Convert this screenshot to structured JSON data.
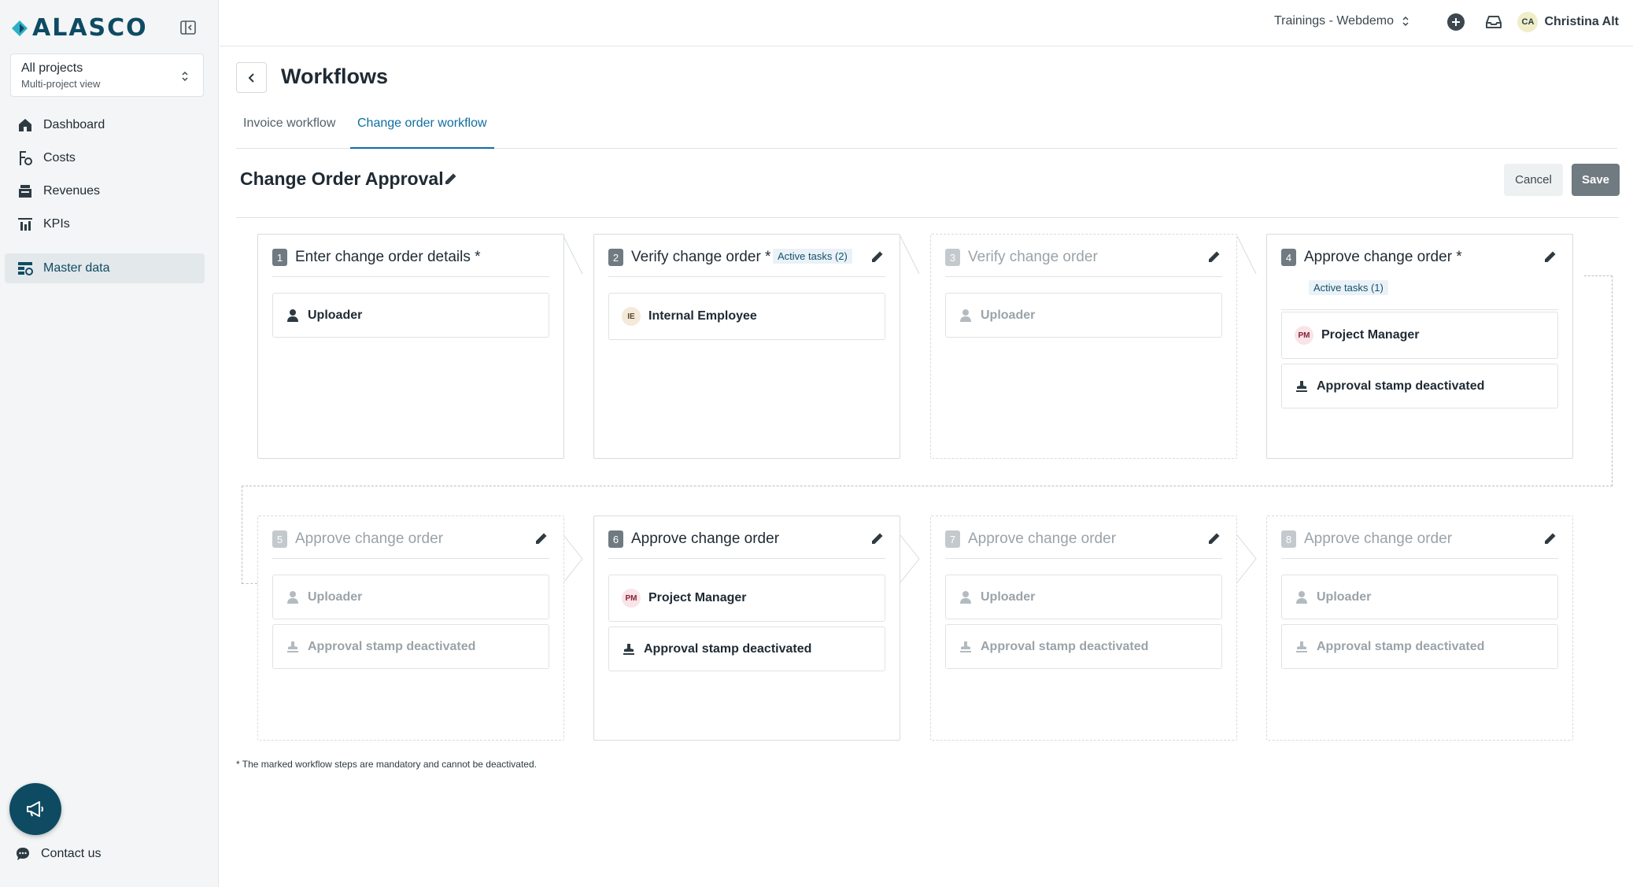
{
  "brand": {
    "name": "ALASCO",
    "accent": "#0e4b63",
    "link": "#0e6fa0"
  },
  "project_selector": {
    "title": "All projects",
    "subtitle": "Multi-project view"
  },
  "nav": {
    "items": [
      {
        "label": "Dashboard",
        "icon": "home-icon"
      },
      {
        "label": "Costs",
        "icon": "costs-icon"
      },
      {
        "label": "Revenues",
        "icon": "revenues-icon"
      },
      {
        "label": "KPIs",
        "icon": "kpis-icon"
      }
    ],
    "master_data": "Master data",
    "contact": "Contact us"
  },
  "topbar": {
    "tenant": "Trainings - Webdemo",
    "user_initials": "CA",
    "user_name": "Christina Alt"
  },
  "page": {
    "title": "Workflows",
    "tabs": [
      "Invoice workflow",
      "Change order workflow"
    ],
    "active_tab": "Change order workflow",
    "workflow_title": "Change Order Approval",
    "cancel": "Cancel",
    "save": "Save",
    "footnote": "* The marked workflow steps are mandatory and cannot be deactivated."
  },
  "steps": [
    {
      "num": "1",
      "title": "Enter change order details *",
      "active": true,
      "assignee": "Uploader"
    },
    {
      "num": "2",
      "title": "Verify change order *",
      "badge": "Active tasks (2)",
      "active": true,
      "assignee": "Internal Employee",
      "assignee_initials": "IE"
    },
    {
      "num": "3",
      "title": "Verify change order",
      "active": false,
      "assignee": "Uploader"
    },
    {
      "num": "4",
      "title": "Approve change order *",
      "badge": "Active tasks (1)",
      "active": true,
      "assignee": "Project Manager",
      "assignee_initials": "PM",
      "stamp": "Approval stamp deactivated"
    },
    {
      "num": "5",
      "title": "Approve change order",
      "active": false,
      "assignee": "Uploader",
      "stamp": "Approval stamp deactivated"
    },
    {
      "num": "6",
      "title": "Approve change order",
      "active": true,
      "assignee": "Project Manager",
      "assignee_initials": "PM",
      "stamp": "Approval stamp deactivated"
    },
    {
      "num": "7",
      "title": "Approve change order",
      "active": false,
      "assignee": "Uploader",
      "stamp": "Approval stamp deactivated"
    },
    {
      "num": "8",
      "title": "Approve change order",
      "active": false,
      "assignee": "Uploader",
      "stamp": "Approval stamp deactivated"
    }
  ]
}
